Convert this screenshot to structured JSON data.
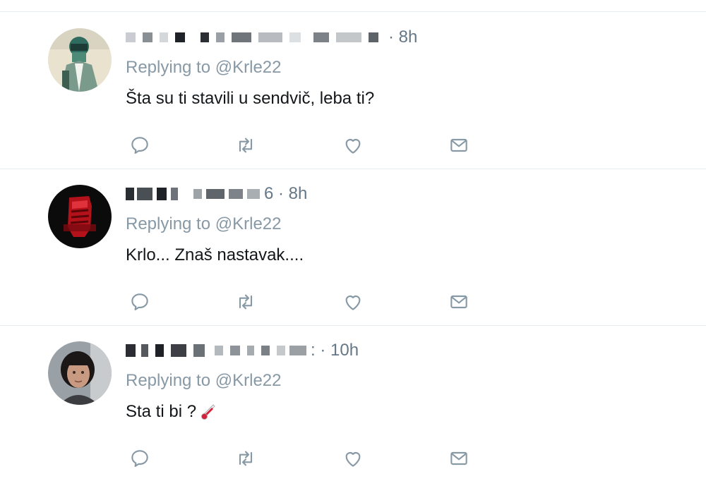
{
  "tweets": [
    {
      "time": "· 8h",
      "replying_prefix": "Replying to",
      "reply_handle": "@Krle22",
      "text": "Šta su ti stavili u sendvič, leba ti?",
      "avatar_icon": "avatar-masked-person"
    },
    {
      "time": "6 · 8h",
      "replying_prefix": "Replying to",
      "reply_handle": "@Krle22",
      "text": "Krlo... Znaš nastavak....",
      "avatar_icon": "avatar-red-fist"
    },
    {
      "time": ": · 10h",
      "replying_prefix": "Replying to",
      "reply_handle": "@Krle22",
      "text": "Sta ti bi ?",
      "emoji_icon": "thermometer-icon",
      "avatar_icon": "avatar-woman-photo"
    }
  ],
  "action_icons": [
    "reply-icon",
    "retweet-icon",
    "like-icon",
    "message-icon"
  ],
  "colors": {
    "muted": "#657786",
    "secondary": "#8899a6",
    "text": "#14171a",
    "divider": "#e6ecf0",
    "icon": "#8899a6"
  }
}
